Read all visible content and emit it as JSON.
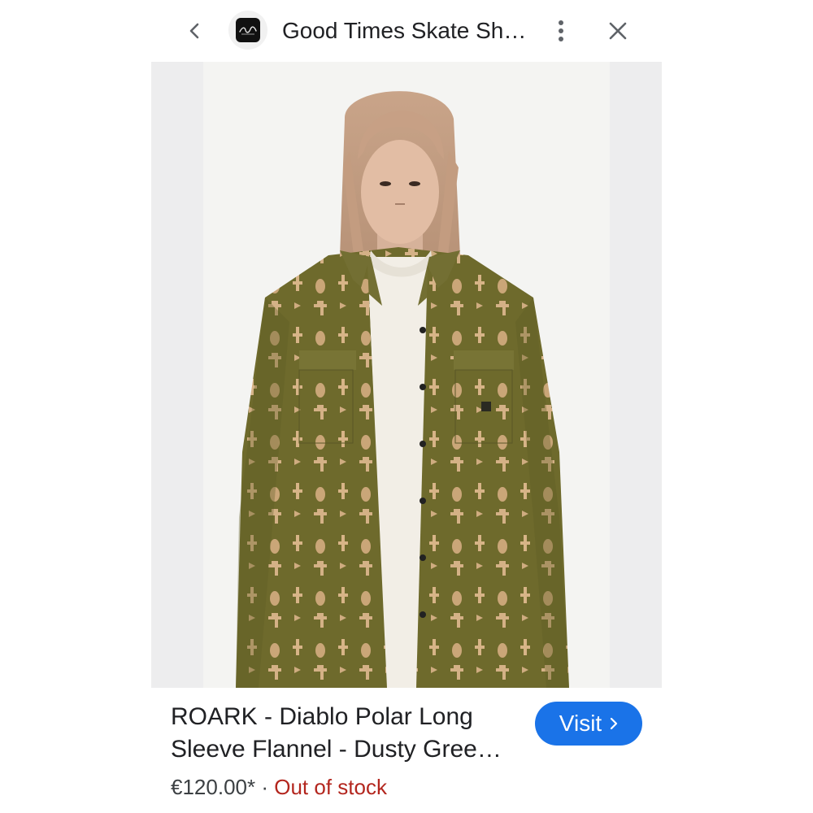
{
  "header": {
    "title": "Good Times Skate Sh…",
    "icons": {
      "back": "chevron-left-icon",
      "more": "more-vert-icon",
      "close": "close-icon",
      "site_logo": "store-logo"
    }
  },
  "product": {
    "title_line1": "ROARK - Diablo Polar Long",
    "title_line2": "Sleeve Flannel - Dusty Gree…",
    "price": "€120.00*",
    "separator": "·",
    "stock": "Out of stock",
    "visit_label": "Visit",
    "image_alt": "Model wearing olive patterned long sleeve flannel over white t-shirt"
  },
  "colors": {
    "accent": "#1a73e8",
    "out_of_stock": "#b3261e",
    "text_primary": "#202124",
    "image_bg": "#ededee"
  }
}
